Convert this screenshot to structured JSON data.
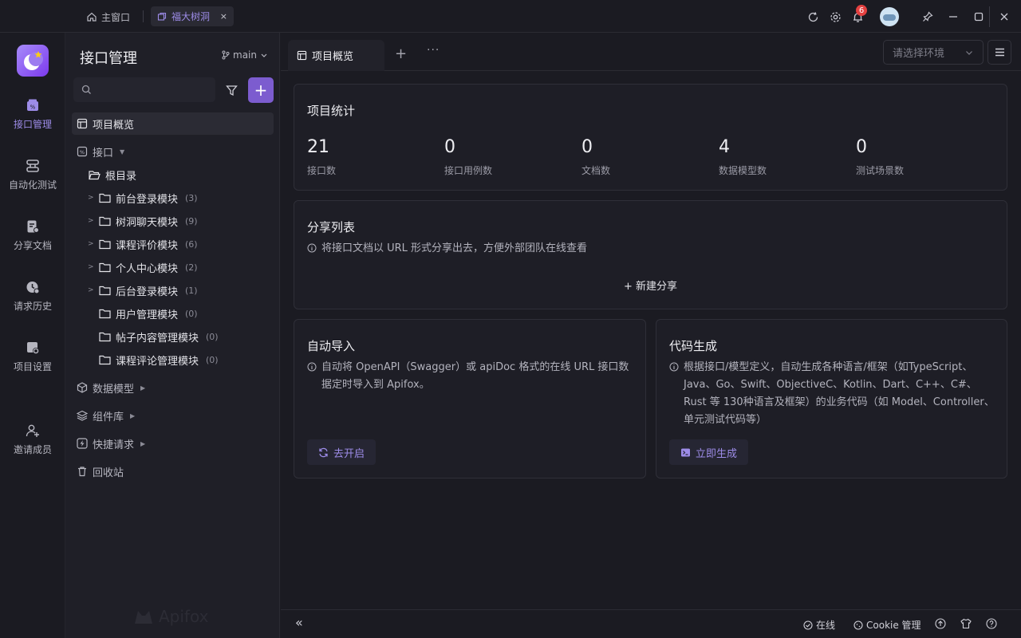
{
  "titlebar": {
    "home_label": "主窗口",
    "tab_label": "福大树洞",
    "close_glyph": "×",
    "notification_count": "6",
    "icons": [
      "refresh-icon",
      "settings-icon",
      "bell-icon",
      "pin-icon",
      "minimize-icon",
      "maximize-icon",
      "close-icon"
    ]
  },
  "rail": {
    "items": [
      {
        "label": "接口管理",
        "icon": "api-icon",
        "active": true
      },
      {
        "label": "自动化测试",
        "icon": "automation-icon"
      },
      {
        "label": "分享文档",
        "icon": "share-doc-icon"
      },
      {
        "label": "请求历史",
        "icon": "history-icon"
      },
      {
        "label": "项目设置",
        "icon": "project-settings-icon"
      },
      {
        "label": "邀请成员",
        "icon": "invite-icon"
      }
    ]
  },
  "panel": {
    "title": "接口管理",
    "branch": "main",
    "add_glyph": "+",
    "overview": "项目概览",
    "api_label": "接口",
    "root_label": "根目录",
    "folders": [
      {
        "name": "前台登录模块",
        "count": "(3)",
        "expandable": true
      },
      {
        "name": "树洞聊天模块",
        "count": "(9)",
        "expandable": true
      },
      {
        "name": "课程评价模块",
        "count": "(6)",
        "expandable": true
      },
      {
        "name": "个人中心模块",
        "count": "(2)",
        "expandable": true
      },
      {
        "name": "后台登录模块",
        "count": "(1)",
        "expandable": true
      },
      {
        "name": "用户管理模块",
        "count": "(0)",
        "expandable": false
      },
      {
        "name": "帖子内容管理模块",
        "count": "(0)",
        "expandable": false
      },
      {
        "name": "课程评论管理模块",
        "count": "(0)",
        "expandable": false
      }
    ],
    "data_model": "数据模型",
    "components": "组件库",
    "quick_request": "快捷请求",
    "recycle": "回收站",
    "watermark": "Apifox"
  },
  "tabs": {
    "active": "项目概览",
    "add": "+",
    "more": "···",
    "env_placeholder": "请选择环境"
  },
  "stats": {
    "title": "项目统计",
    "items": [
      {
        "value": "21",
        "label": "接口数"
      },
      {
        "value": "0",
        "label": "接口用例数"
      },
      {
        "value": "0",
        "label": "文档数"
      },
      {
        "value": "4",
        "label": "数据模型数"
      },
      {
        "value": "0",
        "label": "测试场景数"
      }
    ]
  },
  "share": {
    "title": "分享列表",
    "desc": "将接口文档以 URL 形式分享出去，方便外部团队在线查看",
    "new_label": "+ 新建分享"
  },
  "import": {
    "title": "自动导入",
    "desc": "自动将 OpenAPI（Swagger）或 apiDoc 格式的在线 URL 接口数据定时导入到 Apifox。",
    "button": "去开启"
  },
  "codegen": {
    "title": "代码生成",
    "desc": "根据接口/模型定义，自动生成各种语言/框架（如TypeScript、Java、Go、Swift、ObjectiveC、Kotlin、Dart、C++、C#、Rust 等 130种语言及框架）的业务代码（如 Model、Controller、单元测试代码等）",
    "button": "立即生成"
  },
  "status": {
    "collapse": "«",
    "online": "在线",
    "cookie": "Cookie 管理"
  }
}
